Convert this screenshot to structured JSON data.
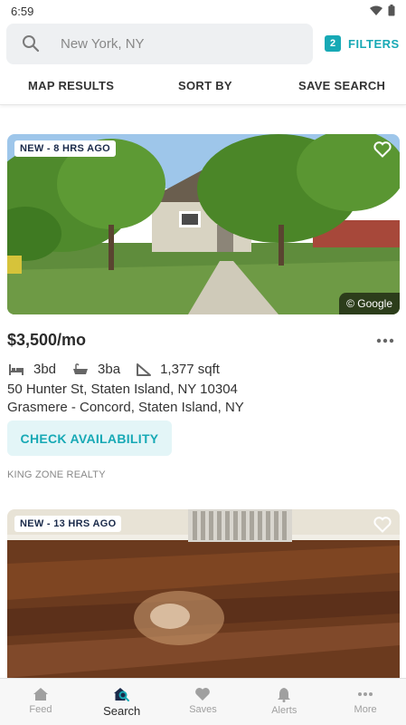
{
  "status": {
    "time": "6:59"
  },
  "search": {
    "placeholder": "New York, NY",
    "filters_count": "2",
    "filters_label": "FILTERS"
  },
  "actions": {
    "map": "MAP RESULTS",
    "sort": "SORT BY",
    "save": "SAVE SEARCH"
  },
  "listings": [
    {
      "badge": "NEW - 8 HRS AGO",
      "credit": "© Google",
      "price": "$3,500/mo",
      "beds": "3bd",
      "baths": "3ba",
      "sqft": "1,377 sqft",
      "address": "50 Hunter St, Staten Island, NY 10304",
      "neighborhood": "Grasmere - Concord, Staten Island, NY",
      "cta": "CHECK AVAILABILITY",
      "agency": "KING ZONE REALTY"
    },
    {
      "badge": "NEW - 13 HRS AGO"
    }
  ],
  "nav": [
    {
      "label": "Feed",
      "icon": "home-icon"
    },
    {
      "label": "Search",
      "icon": "search-home-icon"
    },
    {
      "label": "Saves",
      "icon": "heart-icon"
    },
    {
      "label": "Alerts",
      "icon": "bell-icon"
    },
    {
      "label": "More",
      "icon": "more-icon"
    }
  ],
  "colors": {
    "accent": "#17a9b5",
    "accent_light": "#e3f5f7",
    "badge_text": "#1a2a4a"
  }
}
